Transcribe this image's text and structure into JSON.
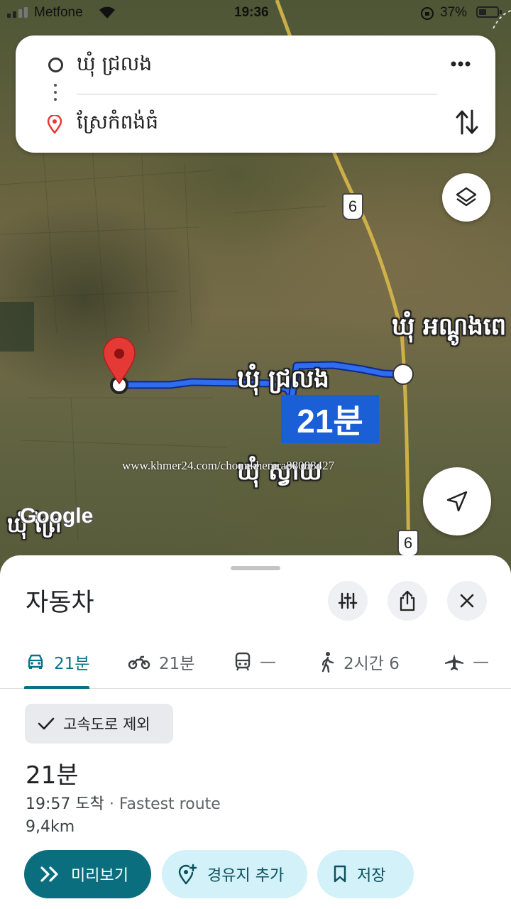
{
  "status_bar": {
    "carrier": "Metfone",
    "time": "19:36",
    "battery": "37%"
  },
  "route_card": {
    "origin": "ឃុំ ជ្រលង",
    "destination": "ស្រែកំពង់ធំ"
  },
  "map": {
    "labels": {
      "origin_label": "ឃុំ ជ្រលង",
      "east_label": "ឃុំ អណ្តូងពេ",
      "south_label": "ឃុំ ស្វាយ",
      "west_label": "ឃុំ ព្រៃ"
    },
    "route_time": "21분",
    "highway_shield": "6",
    "watermark": "www.khmer24.com/chounkhemra88088427",
    "attribution": "Google"
  },
  "sheet": {
    "title": "자동차",
    "tabs": [
      {
        "icon": "car-icon",
        "label": "21분"
      },
      {
        "icon": "motorcycle-icon",
        "label": "21분"
      },
      {
        "icon": "transit-icon",
        "label": "—"
      },
      {
        "icon": "walk-icon",
        "label": "2시간 6"
      },
      {
        "icon": "flight-icon",
        "label": "—"
      }
    ],
    "filter_chip": "고속도로 제외",
    "duration": "21분",
    "arrival": "19:57 도착",
    "separator": " · ",
    "route_type": "Fastest route",
    "distance": "9,4km",
    "actions": {
      "preview": "미리보기",
      "add_stop": "경유지 추가",
      "save": "저장"
    }
  },
  "colors": {
    "route_blue": "#1a5fd6",
    "accent_teal": "#0b6e7e",
    "secondary_button": "#d2f1f8"
  }
}
